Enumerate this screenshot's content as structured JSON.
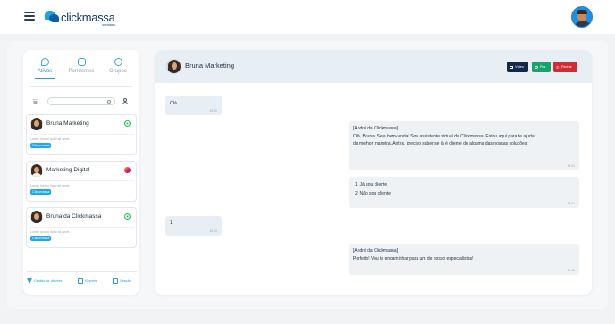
{
  "header": {
    "logo_text": "clickmassa",
    "logo_tm": "SOFTWARE"
  },
  "sidebar": {
    "tabs": [
      {
        "label": "Ativos",
        "icon": "chat-bubble-icon",
        "active": true
      },
      {
        "label": "Pendentes",
        "icon": "pending-chat-icon",
        "active": false
      },
      {
        "label": "Grupos",
        "icon": "group-icon",
        "active": false
      }
    ],
    "search": {
      "placeholder": "",
      "value": ""
    },
    "contacts": [
      {
        "name": "Bruna Marketing",
        "preview": "Lorem ipsum dolor sit amet.",
        "tag": "Clickmassa",
        "channel": "whatsapp-icon"
      },
      {
        "name": "Marketing Digital",
        "preview": "Lorem ipsum dolor sit amet.",
        "tag": "Clickmassa",
        "channel": "instagram-icon"
      },
      {
        "name": "Bruna da Clickmassa",
        "preview": "Lorem ipsum dolor sit amet.",
        "tag": "Clickmassa",
        "channel": "whatsapp-icon"
      }
    ],
    "footer": [
      {
        "label": "Gestão de clientes",
        "icon": "funnel-icon"
      },
      {
        "label": "Reports",
        "icon": "briefcase-icon"
      },
      {
        "label": "Sessão",
        "icon": "calendar-icon"
      }
    ]
  },
  "chat": {
    "contact_name": "Bruna Marketing",
    "buttons": {
      "video": "Vídeo",
      "fila": "Fila",
      "fechar": "Fechar"
    },
    "messages": [
      {
        "dir": "in",
        "text": "Olá",
        "time": "12:00"
      },
      {
        "dir": "out",
        "sender": "[André da Clickmassa]",
        "lines": [
          "Olá, Bruna. Seja bem-vinda! Sou assistente virtual da Clickmassa. Estou aqui para te ajudar",
          "da melhor maneira. Antes, preciso saber se já é cliente de alguma das nossas soluções:"
        ],
        "time": "12:01"
      },
      {
        "dir": "out",
        "lines": [
          "1. Já sou cliente",
          "2. Não sou cliente"
        ],
        "time": "12:01"
      },
      {
        "dir": "in",
        "text": "1",
        "time": "12:02"
      },
      {
        "dir": "out",
        "sender": "[André da Clickmassa]",
        "lines": [
          "Perfeito! Vou te encaminhar para um de nosso especialistas!"
        ],
        "time": "12:03"
      }
    ]
  },
  "colors": {
    "accent": "#2b9ad6",
    "video_btn": "#13294b",
    "fila_btn": "#17a36a",
    "fechar_btn": "#d12b35"
  }
}
